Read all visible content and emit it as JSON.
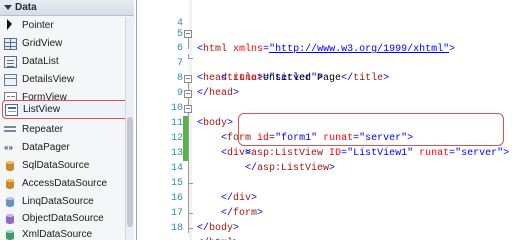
{
  "toolbox": {
    "section_title": "Data",
    "items": [
      {
        "label": "Pointer",
        "icon": "pointer-icon"
      },
      {
        "label": "GridView",
        "icon": "grid-icon"
      },
      {
        "label": "DataList",
        "icon": "list-icon"
      },
      {
        "label": "DetailsView",
        "icon": "details-icon"
      },
      {
        "label": "FormView",
        "icon": "form-icon"
      },
      {
        "label": "ListView",
        "icon": "listview-icon",
        "selected": true
      },
      {
        "label": "Repeater",
        "icon": "repeater-icon"
      },
      {
        "label": "DataPager",
        "icon": "pager-icon",
        "glyph": "«»"
      },
      {
        "label": "SqlDataSource",
        "icon": "database-icon"
      },
      {
        "label": "AccessDataSource",
        "icon": "database-icon"
      },
      {
        "label": "LinqDataSource",
        "icon": "database-icon"
      },
      {
        "label": "ObjectDataSource",
        "icon": "database-icon"
      },
      {
        "label": "XmlDataSource",
        "icon": "database-icon"
      }
    ]
  },
  "editor": {
    "line_numbers": [
      "4",
      "5",
      "6",
      "7",
      "8",
      "9",
      "10",
      "11",
      "12",
      "13",
      "14",
      "15",
      "16",
      "17",
      "18"
    ],
    "lines": {
      "l4": "",
      "l5": {
        "open": "<",
        "tag": "html",
        "attr": " xmlns",
        "eq": "=",
        "val": "\"http://www.w3.org/1999/xhtml\"",
        "close": ">"
      },
      "l6": {
        "open": "<",
        "tag": "head",
        "attr": " runat",
        "eq": "=",
        "val": "\"server\"",
        "close": ">"
      },
      "l7": {
        "open": "<",
        "tag": "title",
        "close": ">",
        "text": "Untitled Page",
        "open2": "</",
        "tag2": "title",
        "close2": ">"
      },
      "l8": {
        "open": "</",
        "tag": "head",
        "close": ">"
      },
      "l9": {
        "open": "<",
        "tag": "body",
        "close": ">"
      },
      "l10": {
        "open": "<",
        "tag": "form",
        "attr1": " id",
        "eq1": "=",
        "val1": "\"form1\"",
        "attr2": " runat",
        "eq2": "=",
        "val2": "\"server\"",
        "close": ">"
      },
      "l11": {
        "open": "<",
        "tag": "div",
        "close": ">"
      },
      "l12": {
        "open": "<",
        "tag": "asp:ListView",
        "attr1": " ID",
        "eq1": "=",
        "val1": "\"ListView1\"",
        "attr2": " runat",
        "eq2": "=",
        "val2": "\"server\"",
        "close": ">"
      },
      "l13": {
        "open": "</",
        "tag": "asp:ListView",
        "close": ">"
      },
      "l14": "",
      "l15": {
        "open": "</",
        "tag": "div",
        "close": ">"
      },
      "l16": {
        "open": "</",
        "tag": "form",
        "close": ">"
      },
      "l17": {
        "open": "</",
        "tag": "body",
        "close": ">"
      },
      "l18": {
        "open": "</",
        "tag": "html",
        "close": ">"
      }
    }
  },
  "colors": {
    "tag_bracket": "#0000ff",
    "element_name": "#a31515",
    "attribute": "#ff0000",
    "attribute_value": "#0000ff",
    "line_number": "#2b91af",
    "changed_marker": "#55b447",
    "highlight_border": "#d9534f"
  }
}
